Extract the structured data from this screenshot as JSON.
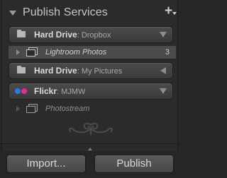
{
  "panel": {
    "title": "Publish Services",
    "add_label": "+"
  },
  "services": [
    {
      "name": "Hard Drive",
      "sub": ": Dropbox",
      "icon": "folder-icon",
      "state": "expanded"
    },
    {
      "name": "Hard Drive",
      "sub": ": My Pictures",
      "icon": "folder-icon",
      "state": "collapsed"
    },
    {
      "name": "Flickr",
      "sub": ": MJMW",
      "icon": "flickr-icon",
      "state": "expanded"
    }
  ],
  "collections": [
    {
      "name": "Lightroom Photos",
      "count": "3",
      "selected": true
    },
    {
      "name": "Photostream",
      "count": "",
      "selected": false
    }
  ],
  "buttons": {
    "import_label": "Import...",
    "publish_label": "Publish"
  },
  "colors": {
    "flickr_blue": "#2a7be0",
    "flickr_pink": "#e0308f",
    "panel_bg": "#2b2b2b",
    "selected_row": "#4a4a4a"
  }
}
